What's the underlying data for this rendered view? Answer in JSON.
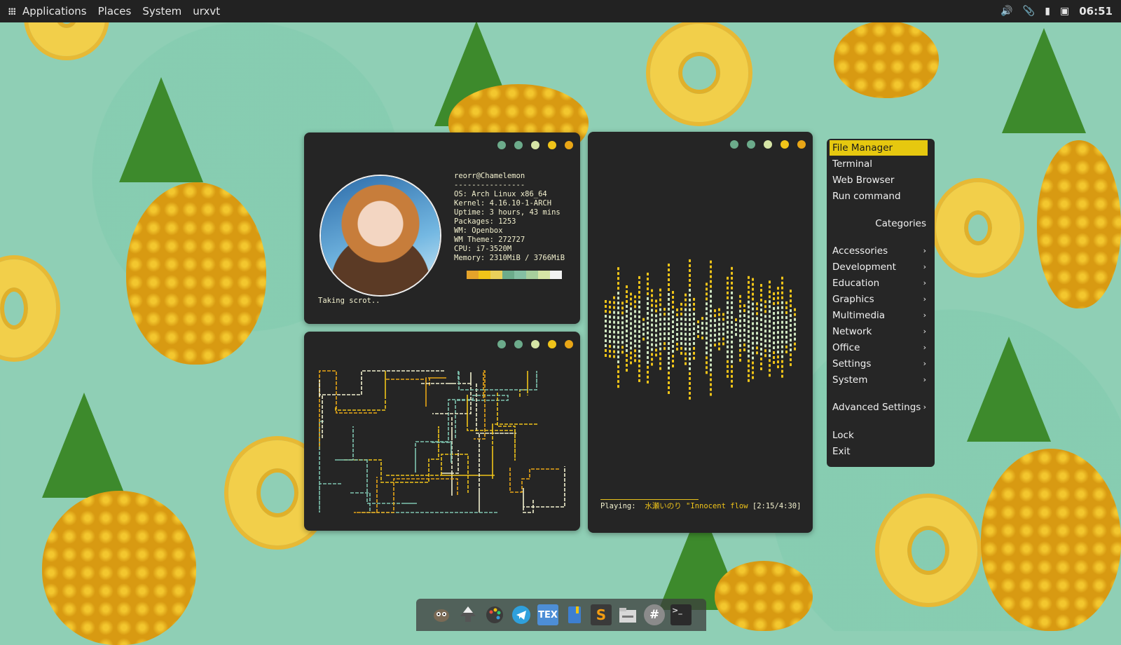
{
  "top_panel": {
    "menus": [
      "Applications",
      "Places",
      "System",
      "urxvt"
    ],
    "tray_icons": [
      "volume-icon",
      "paperclip-icon",
      "battery-icon",
      "info-icon"
    ],
    "clock": "06:51"
  },
  "window_dots": [
    "#6cab8b",
    "#6cab8b",
    "#d6e5a6",
    "#f0c419",
    "#e9a616"
  ],
  "neofetch": {
    "user": "reorr@Chamelemon",
    "separator": "----------------",
    "os": "OS: Arch Linux x86_64",
    "kernel": "Kernel: 4.16.10-1-ARCH",
    "uptime": "Uptime: 3 hours, 43 mins",
    "packages": "Packages: 1253",
    "wm": "WM: Openbox",
    "wm_theme": "WM Theme: 272727",
    "cpu": "CPU: i7-3520M",
    "memory": "Memory: 2310MiB / 3766MiB",
    "palette": [
      "#e5a32a",
      "#f0c419",
      "#e9d05a",
      "#6cab8b",
      "#84bfa3",
      "#a7cf9c",
      "#d6e5a6",
      "#f2f2f2"
    ],
    "status": "Taking scrot.."
  },
  "music": {
    "label": "Playing:",
    "title": "水瀬いのり \"Innocent flow",
    "time": "[2:15/4:30]"
  },
  "openbox_menu": {
    "file_manager": "File Manager",
    "terminal": "Terminal",
    "web_browser": "Web Browser",
    "run_command": "Run command",
    "categories": "Categories",
    "accessories": "Accessories",
    "development": "Development",
    "education": "Education",
    "graphics": "Graphics",
    "multimedia": "Multimedia",
    "network": "Network",
    "office": "Office",
    "settings": "Settings",
    "system": "System",
    "advanced_settings": "Advanced Settings",
    "lock": "Lock",
    "exit": "Exit",
    "arrow": "›"
  },
  "dock": {
    "tex_label": "TEX",
    "sublime_label": "S",
    "hash_label": "#",
    "terminal_label": ">_"
  }
}
